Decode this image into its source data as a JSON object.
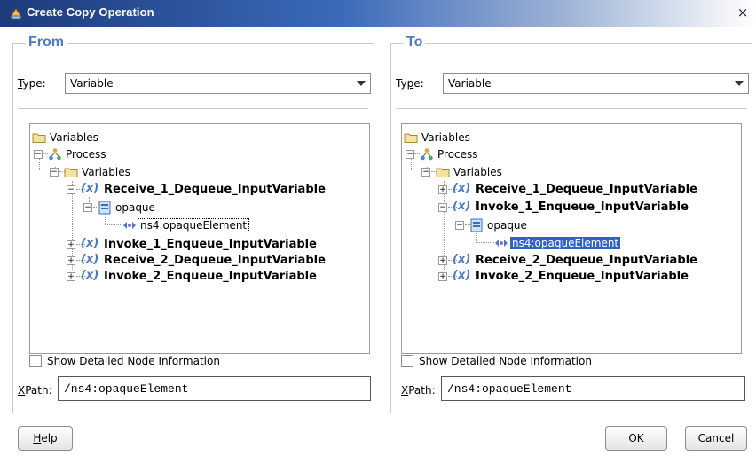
{
  "window": {
    "title": "Create Copy Operation",
    "close_glyph": "×"
  },
  "from": {
    "legend": "From",
    "type_label_mnemonic": "T",
    "type_label_rest": "ype:",
    "type_value": "Variable",
    "tree": {
      "root": "Variables",
      "process": "Process",
      "variables": "Variables",
      "items": [
        "Receive_1_Dequeue_InputVariable",
        "opaque",
        "ns4:opaqueElement",
        "Invoke_1_Enqueue_InputVariable",
        "Receive_2_Dequeue_InputVariable",
        "Invoke_2_Enqueue_InputVariable"
      ],
      "selected": "ns4:opaqueElement",
      "expanded": "Receive_1_Dequeue_InputVariable"
    },
    "show_detail_mnemonic": "S",
    "show_detail_rest": "how Detailed Node Information",
    "show_detail_checked": false,
    "xpath_label_mnemonic": "X",
    "xpath_label_rest": "Path:",
    "xpath_value": "/ns4:opaqueElement"
  },
  "to": {
    "legend": "To",
    "type_label_pre": "Ty",
    "type_label_mnemonic": "p",
    "type_label_rest": "e:",
    "type_value": "Variable",
    "tree": {
      "root": "Variables",
      "process": "Process",
      "variables": "Variables",
      "items": [
        "Receive_1_Dequeue_InputVariable",
        "Invoke_1_Enqueue_InputVariable",
        "opaque",
        "ns4:opaqueElement",
        "Receive_2_Dequeue_InputVariable",
        "Invoke_2_Enqueue_InputVariable"
      ],
      "selected": "ns4:opaqueElement",
      "expanded": "Invoke_1_Enqueue_InputVariable"
    },
    "show_detail_mnemonic": "S",
    "show_detail_rest": "how Detailed Node Information",
    "show_detail_checked": false,
    "xpath_label_mnemonic": "X",
    "xpath_label_rest": "Path:",
    "xpath_value": "/ns4:opaqueElement"
  },
  "buttons": {
    "help_mnemonic": "H",
    "help_rest": "elp",
    "ok": "OK",
    "cancel": "Cancel"
  },
  "icons": {
    "title": "bpel-copy-icon",
    "folder": "folder-icon",
    "process": "process-icon",
    "variable": "variable-x-icon",
    "message_part": "message-part-icon",
    "element": "element-icon",
    "expand": "expand-icon",
    "collapse": "collapse-icon"
  },
  "colors": {
    "title_gradient_start": "#1c3b7a",
    "legend": "#4c7ac7",
    "variable_icon": "#4a78c8",
    "selection": "#3163c5"
  }
}
